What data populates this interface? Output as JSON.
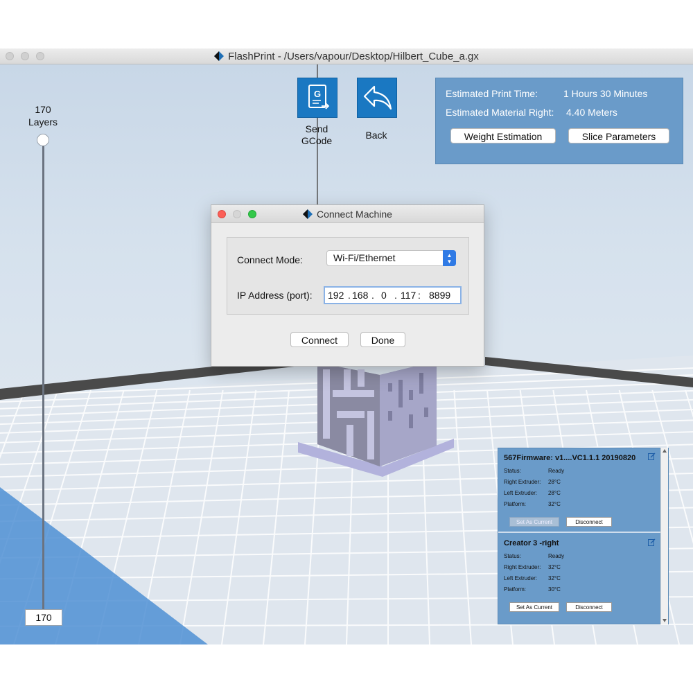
{
  "window": {
    "title": "FlashPrint - /Users/vapour/Desktop/Hilbert_Cube_a.gx"
  },
  "layers": {
    "count": "170",
    "label": "Layers",
    "current": "170"
  },
  "toolbar": {
    "send_gcode_label_1": "Send",
    "send_gcode_label_2": "GCode",
    "back_label": "Back",
    "gcode_glyph": "G"
  },
  "print_info": {
    "time_label": "Estimated Print Time:",
    "time_value": "1 Hours 30 Minutes",
    "material_label": "Estimated Material Right:",
    "material_value": "4.40 Meters",
    "weight_button": "Weight Estimation",
    "slice_button": "Slice Parameters"
  },
  "dialog": {
    "title": "Connect Machine",
    "mode_label": "Connect Mode:",
    "mode_value": "Wi-Fi/Ethernet",
    "ip_label": "IP Address (port):",
    "ip": [
      "192",
      "168",
      "0",
      "117"
    ],
    "port": "8899",
    "dot": ".",
    "colon": ":",
    "connect_button": "Connect",
    "done_button": "Done"
  },
  "machines": [
    {
      "name": "567Firmware: v1....VC1.1.1 20190820",
      "status_label": "Status:",
      "status_value": "Ready",
      "right_label": "Right Extruder:",
      "right_value": "28°C",
      "left_label": "Left Extruder:",
      "left_value": "28°C",
      "platform_label": "Platform:",
      "platform_value": "32°C",
      "set_current": "Set As Current",
      "disconnect": "Disconnect"
    },
    {
      "name": "Creator 3 -right",
      "status_label": "Status:",
      "status_value": "Ready",
      "right_label": "Right Extruder:",
      "right_value": "32°C",
      "left_label": "Left Extruder:",
      "left_value": "32°C",
      "platform_label": "Platform:",
      "platform_value": "30°C",
      "set_current": "Set As Current",
      "disconnect": "Disconnect"
    }
  ],
  "colors": {
    "accent": "#1a78c2",
    "panel": "#6a9bc9",
    "grid": "#ffffff",
    "model": "#9a9ab4"
  }
}
